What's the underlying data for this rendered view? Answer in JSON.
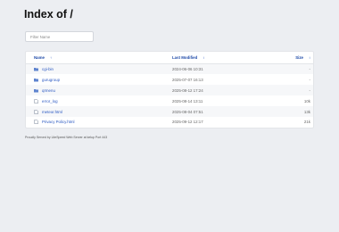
{
  "page": {
    "title": "Index of /"
  },
  "filter": {
    "placeholder": "Filter Name"
  },
  "table": {
    "headers": {
      "name": "Name",
      "name_sort_arrow": "↑",
      "modified": "Last Modified",
      "modified_sort_arrow": "↕",
      "size": "Size",
      "size_sort_arrow": "↕"
    },
    "rows": [
      {
        "name": "cgi-bin",
        "modified": "2024-06-06 10:31",
        "size": "-",
        "type": "folder"
      },
      {
        "name": "gurugroup",
        "modified": "2025-07-07 16:13",
        "size": "-",
        "type": "folder"
      },
      {
        "name": "qrmenu",
        "modified": "2025-08-12 17:24",
        "size": "-",
        "type": "folder"
      },
      {
        "name": "error_log",
        "modified": "2025-08-14 13:11",
        "size": "10k",
        "type": "file"
      },
      {
        "name": "meteor.html",
        "modified": "2025-08-04 07:51",
        "size": "13k",
        "type": "file"
      },
      {
        "name": "Privacy Policy.html",
        "modified": "2025-09-12 12:17",
        "size": "21k",
        "type": "file"
      }
    ]
  },
  "footer": {
    "text": "Proudly Served by LiteSpeed Web Server at kelup Port 443"
  },
  "colors": {
    "folder": "#5f84cf",
    "file": "#7a8699",
    "link": "#2a58c2",
    "accent": "#1f4aa8"
  }
}
